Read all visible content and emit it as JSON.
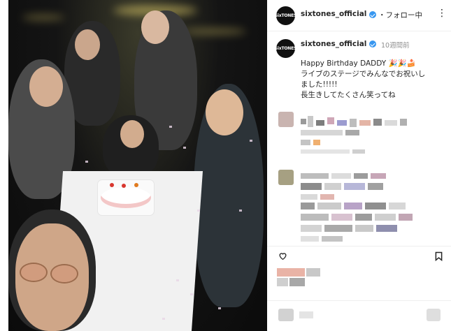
{
  "post": {
    "account": "sixtones_official",
    "avatar_text": "SixTONES",
    "follow_label": "・フォロー中",
    "more_label": "⋮",
    "time_ago": "10週間前",
    "caption_lines": [
      "Happy Birthday DADDY 🎉🎉🍰",
      "ライブのステージでみんなでお祝いし",
      "ました!!!!!",
      "長生きしてたくさん笑ってね"
    ]
  },
  "colors": {
    "accent": "#3897f0",
    "text": "#262626",
    "muted": "#8e8e8e",
    "photo_bg": "#0b0b0b"
  },
  "icons": [
    "verified-icon",
    "more-icon",
    "heart-icon",
    "save-icon"
  ]
}
